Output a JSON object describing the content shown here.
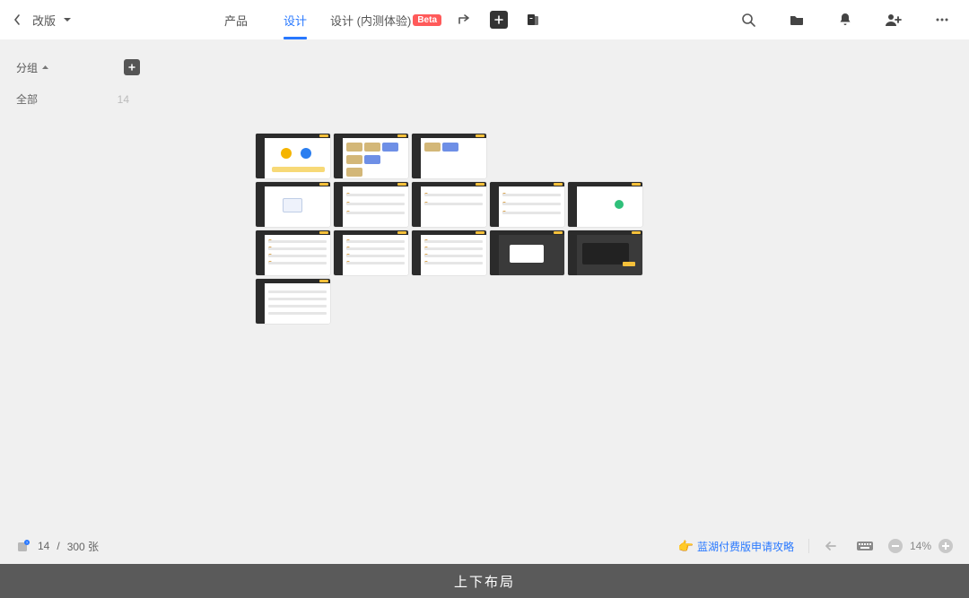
{
  "header": {
    "project_name": "改版",
    "tabs": [
      {
        "label": "产品",
        "active": false
      },
      {
        "label": "设计",
        "active": true
      }
    ],
    "beta_tab": {
      "label": "设计 (内测体验)",
      "badge": "Beta"
    }
  },
  "sidebar": {
    "group_header": "分组",
    "items": [
      {
        "label": "全部",
        "count": "14"
      }
    ]
  },
  "canvas": {
    "thumbnail_count": 14
  },
  "statusbar": {
    "count_current": "14",
    "count_sep": " / ",
    "count_total": "300 张",
    "promo_text": "蓝湖付费版申请攻略",
    "zoom_percent": "14%"
  },
  "caption": "上下布局"
}
